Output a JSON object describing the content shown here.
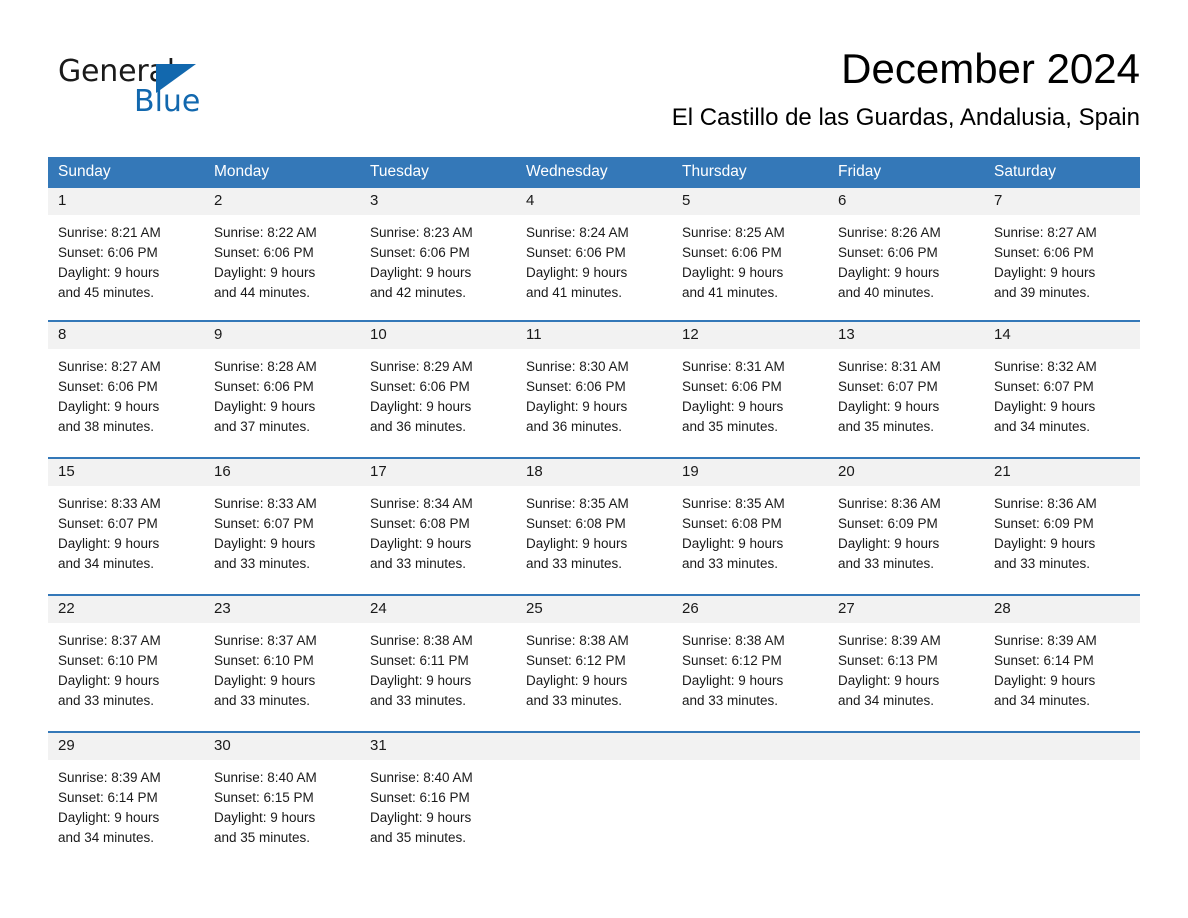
{
  "brand": {
    "name_part1": "General",
    "name_part2": "Blue",
    "triangle_color": "#1268ae",
    "logo_icon": "blue-triangle-icon"
  },
  "header": {
    "title": "December 2024",
    "subtitle": "El Castillo de las Guardas, Andalusia, Spain"
  },
  "colors": {
    "header_blue": "#3478b8",
    "daynum_band": "#f2f2f2",
    "separator_blue": "#3478b8",
    "text": "#1a1a1a"
  },
  "weekday_headers": [
    "Sunday",
    "Monday",
    "Tuesday",
    "Wednesday",
    "Thursday",
    "Friday",
    "Saturday"
  ],
  "weeks": [
    [
      {
        "day": "1",
        "sunrise": "Sunrise: 8:21 AM",
        "sunset": "Sunset: 6:06 PM",
        "daylight1": "Daylight: 9 hours",
        "daylight2": "and 45 minutes."
      },
      {
        "day": "2",
        "sunrise": "Sunrise: 8:22 AM",
        "sunset": "Sunset: 6:06 PM",
        "daylight1": "Daylight: 9 hours",
        "daylight2": "and 44 minutes."
      },
      {
        "day": "3",
        "sunrise": "Sunrise: 8:23 AM",
        "sunset": "Sunset: 6:06 PM",
        "daylight1": "Daylight: 9 hours",
        "daylight2": "and 42 minutes."
      },
      {
        "day": "4",
        "sunrise": "Sunrise: 8:24 AM",
        "sunset": "Sunset: 6:06 PM",
        "daylight1": "Daylight: 9 hours",
        "daylight2": "and 41 minutes."
      },
      {
        "day": "5",
        "sunrise": "Sunrise: 8:25 AM",
        "sunset": "Sunset: 6:06 PM",
        "daylight1": "Daylight: 9 hours",
        "daylight2": "and 41 minutes."
      },
      {
        "day": "6",
        "sunrise": "Sunrise: 8:26 AM",
        "sunset": "Sunset: 6:06 PM",
        "daylight1": "Daylight: 9 hours",
        "daylight2": "and 40 minutes."
      },
      {
        "day": "7",
        "sunrise": "Sunrise: 8:27 AM",
        "sunset": "Sunset: 6:06 PM",
        "daylight1": "Daylight: 9 hours",
        "daylight2": "and 39 minutes."
      }
    ],
    [
      {
        "day": "8",
        "sunrise": "Sunrise: 8:27 AM",
        "sunset": "Sunset: 6:06 PM",
        "daylight1": "Daylight: 9 hours",
        "daylight2": "and 38 minutes."
      },
      {
        "day": "9",
        "sunrise": "Sunrise: 8:28 AM",
        "sunset": "Sunset: 6:06 PM",
        "daylight1": "Daylight: 9 hours",
        "daylight2": "and 37 minutes."
      },
      {
        "day": "10",
        "sunrise": "Sunrise: 8:29 AM",
        "sunset": "Sunset: 6:06 PM",
        "daylight1": "Daylight: 9 hours",
        "daylight2": "and 36 minutes."
      },
      {
        "day": "11",
        "sunrise": "Sunrise: 8:30 AM",
        "sunset": "Sunset: 6:06 PM",
        "daylight1": "Daylight: 9 hours",
        "daylight2": "and 36 minutes."
      },
      {
        "day": "12",
        "sunrise": "Sunrise: 8:31 AM",
        "sunset": "Sunset: 6:06 PM",
        "daylight1": "Daylight: 9 hours",
        "daylight2": "and 35 minutes."
      },
      {
        "day": "13",
        "sunrise": "Sunrise: 8:31 AM",
        "sunset": "Sunset: 6:07 PM",
        "daylight1": "Daylight: 9 hours",
        "daylight2": "and 35 minutes."
      },
      {
        "day": "14",
        "sunrise": "Sunrise: 8:32 AM",
        "sunset": "Sunset: 6:07 PM",
        "daylight1": "Daylight: 9 hours",
        "daylight2": "and 34 minutes."
      }
    ],
    [
      {
        "day": "15",
        "sunrise": "Sunrise: 8:33 AM",
        "sunset": "Sunset: 6:07 PM",
        "daylight1": "Daylight: 9 hours",
        "daylight2": "and 34 minutes."
      },
      {
        "day": "16",
        "sunrise": "Sunrise: 8:33 AM",
        "sunset": "Sunset: 6:07 PM",
        "daylight1": "Daylight: 9 hours",
        "daylight2": "and 33 minutes."
      },
      {
        "day": "17",
        "sunrise": "Sunrise: 8:34 AM",
        "sunset": "Sunset: 6:08 PM",
        "daylight1": "Daylight: 9 hours",
        "daylight2": "and 33 minutes."
      },
      {
        "day": "18",
        "sunrise": "Sunrise: 8:35 AM",
        "sunset": "Sunset: 6:08 PM",
        "daylight1": "Daylight: 9 hours",
        "daylight2": "and 33 minutes."
      },
      {
        "day": "19",
        "sunrise": "Sunrise: 8:35 AM",
        "sunset": "Sunset: 6:08 PM",
        "daylight1": "Daylight: 9 hours",
        "daylight2": "and 33 minutes."
      },
      {
        "day": "20",
        "sunrise": "Sunrise: 8:36 AM",
        "sunset": "Sunset: 6:09 PM",
        "daylight1": "Daylight: 9 hours",
        "daylight2": "and 33 minutes."
      },
      {
        "day": "21",
        "sunrise": "Sunrise: 8:36 AM",
        "sunset": "Sunset: 6:09 PM",
        "daylight1": "Daylight: 9 hours",
        "daylight2": "and 33 minutes."
      }
    ],
    [
      {
        "day": "22",
        "sunrise": "Sunrise: 8:37 AM",
        "sunset": "Sunset: 6:10 PM",
        "daylight1": "Daylight: 9 hours",
        "daylight2": "and 33 minutes."
      },
      {
        "day": "23",
        "sunrise": "Sunrise: 8:37 AM",
        "sunset": "Sunset: 6:10 PM",
        "daylight1": "Daylight: 9 hours",
        "daylight2": "and 33 minutes."
      },
      {
        "day": "24",
        "sunrise": "Sunrise: 8:38 AM",
        "sunset": "Sunset: 6:11 PM",
        "daylight1": "Daylight: 9 hours",
        "daylight2": "and 33 minutes."
      },
      {
        "day": "25",
        "sunrise": "Sunrise: 8:38 AM",
        "sunset": "Sunset: 6:12 PM",
        "daylight1": "Daylight: 9 hours",
        "daylight2": "and 33 minutes."
      },
      {
        "day": "26",
        "sunrise": "Sunrise: 8:38 AM",
        "sunset": "Sunset: 6:12 PM",
        "daylight1": "Daylight: 9 hours",
        "daylight2": "and 33 minutes."
      },
      {
        "day": "27",
        "sunrise": "Sunrise: 8:39 AM",
        "sunset": "Sunset: 6:13 PM",
        "daylight1": "Daylight: 9 hours",
        "daylight2": "and 34 minutes."
      },
      {
        "day": "28",
        "sunrise": "Sunrise: 8:39 AM",
        "sunset": "Sunset: 6:14 PM",
        "daylight1": "Daylight: 9 hours",
        "daylight2": "and 34 minutes."
      }
    ],
    [
      {
        "day": "29",
        "sunrise": "Sunrise: 8:39 AM",
        "sunset": "Sunset: 6:14 PM",
        "daylight1": "Daylight: 9 hours",
        "daylight2": "and 34 minutes."
      },
      {
        "day": "30",
        "sunrise": "Sunrise: 8:40 AM",
        "sunset": "Sunset: 6:15 PM",
        "daylight1": "Daylight: 9 hours",
        "daylight2": "and 35 minutes."
      },
      {
        "day": "31",
        "sunrise": "Sunrise: 8:40 AM",
        "sunset": "Sunset: 6:16 PM",
        "daylight1": "Daylight: 9 hours",
        "daylight2": "and 35 minutes."
      },
      {
        "day": "",
        "sunrise": "",
        "sunset": "",
        "daylight1": "",
        "daylight2": ""
      },
      {
        "day": "",
        "sunrise": "",
        "sunset": "",
        "daylight1": "",
        "daylight2": ""
      },
      {
        "day": "",
        "sunrise": "",
        "sunset": "",
        "daylight1": "",
        "daylight2": ""
      },
      {
        "day": "",
        "sunrise": "",
        "sunset": "",
        "daylight1": "",
        "daylight2": ""
      }
    ]
  ]
}
